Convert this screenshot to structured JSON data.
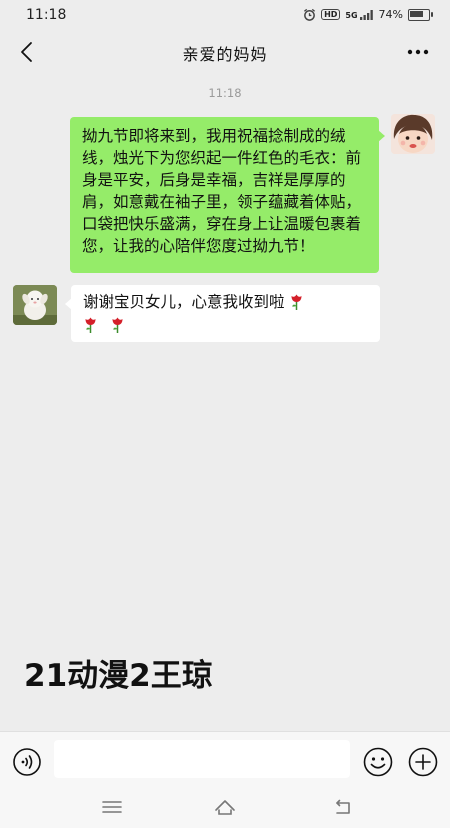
{
  "status_bar": {
    "time": "11:18",
    "hd_label": "HD",
    "network_label": "5G",
    "battery_percent": "74%",
    "battery_level": 0.74
  },
  "header": {
    "title": "亲爱的妈妈"
  },
  "chat": {
    "timestamp": "11:18",
    "messages": [
      {
        "sender": "me",
        "text": "拗九节即将来到，我用祝福捻制成的绒线，烛光下为您织起一件红色的毛衣：前身是平安，后身是幸福，吉祥是厚厚的肩，如意戴在袖子里，领子蕴藏着体贴，口袋把快乐盛满，穿在身上让温暖包裹着您，让我的心陪伴您度过拗九节！"
      },
      {
        "sender": "mom",
        "text": "谢谢宝贝女儿，心意我收到啦",
        "emoji": "rose",
        "emoji_count": 3
      }
    ]
  },
  "watermark": "21动漫2王琼",
  "input_bar": {
    "value": "",
    "placeholder": ""
  },
  "icons": {
    "back": "back-arrow-icon",
    "more": "more-dots-icon",
    "voice": "voice-icon",
    "emoji": "emoji-icon",
    "plus": "plus-icon",
    "menu": "menu-icon",
    "home": "home-icon",
    "return": "return-icon"
  },
  "colors": {
    "background": "#ededed",
    "sent_bubble": "#95ec69",
    "received_bubble": "#ffffff",
    "timestamp": "#9a9a9a"
  }
}
